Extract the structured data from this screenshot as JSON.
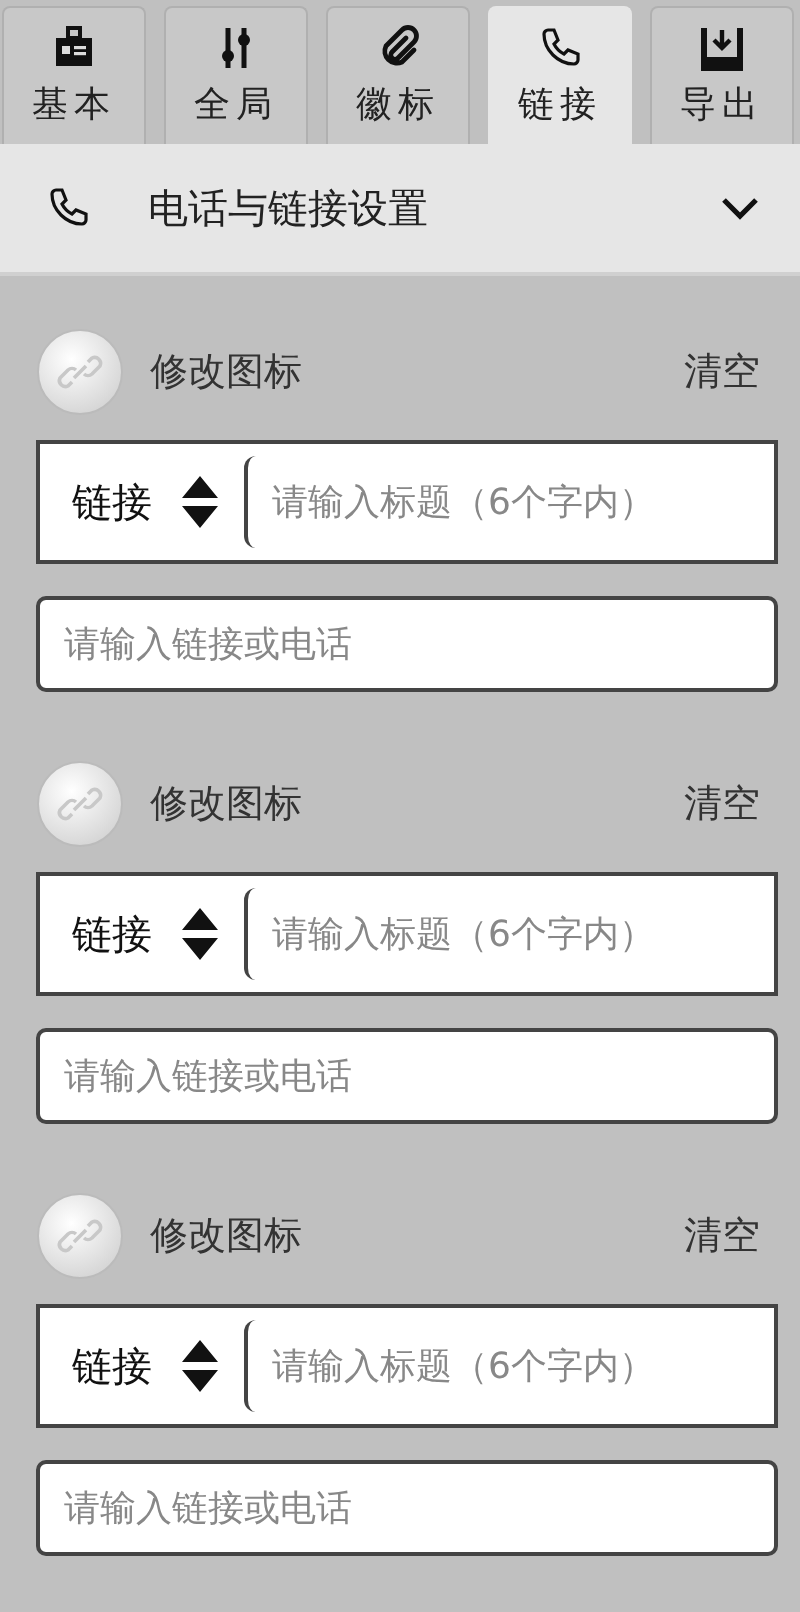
{
  "tabs": [
    {
      "label": "基本",
      "kind": "badge",
      "selected": false
    },
    {
      "label": "全局",
      "kind": "sliders",
      "selected": false
    },
    {
      "label": "徽标",
      "kind": "clip",
      "selected": false
    },
    {
      "label": "链接",
      "kind": "phone",
      "selected": true
    },
    {
      "label": "导出",
      "kind": "download",
      "selected": false
    }
  ],
  "section": {
    "title": "电话与链接设置",
    "expanded": true
  },
  "links": [
    {
      "change_icon": "修改图标",
      "clear": "清空",
      "type": "链接",
      "title_placeholder": "请输入标题（6个字内）",
      "url_placeholder": "请输入链接或电话"
    },
    {
      "change_icon": "修改图标",
      "clear": "清空",
      "type": "链接",
      "title_placeholder": "请输入标题（6个字内）",
      "url_placeholder": "请输入链接或电话"
    },
    {
      "change_icon": "修改图标",
      "clear": "清空",
      "type": "链接",
      "title_placeholder": "请输入标题（6个字内）",
      "url_placeholder": "请输入链接或电话"
    }
  ]
}
